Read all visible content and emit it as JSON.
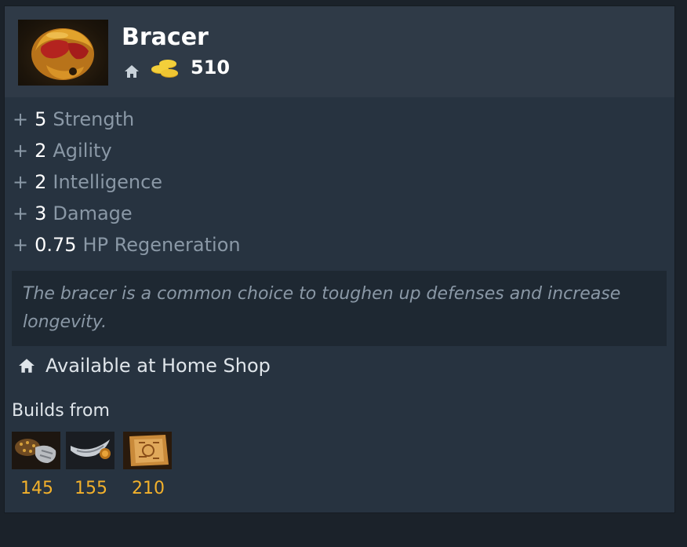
{
  "item": {
    "name": "Bracer",
    "image_icon": "bracer-helmet-icon",
    "cost": "510",
    "shop_icon": "home-icon",
    "currency_icon": "gold-coins-icon"
  },
  "attributes": [
    {
      "plus": "+",
      "value": "5",
      "label": "Strength"
    },
    {
      "plus": "+",
      "value": "2",
      "label": "Agility"
    },
    {
      "plus": "+",
      "value": "2",
      "label": "Intelligence"
    },
    {
      "plus": "+",
      "value": "3",
      "label": "Damage"
    },
    {
      "plus": "+",
      "value": "0.75",
      "label": "HP Regeneration"
    }
  ],
  "lore": "The bracer is a common choice to toughen up defenses and increase longevity.",
  "availability": "Available at Home Shop",
  "builds_from": {
    "title": "Builds from",
    "components": [
      {
        "icon": "gauntlets-icon",
        "price": "145"
      },
      {
        "icon": "circlet-icon",
        "price": "155"
      },
      {
        "icon": "recipe-scroll-icon",
        "price": "210"
      }
    ]
  },
  "colors": {
    "background": "#1b222a",
    "panel": "#273340",
    "header": "#2f3a47",
    "lore_box": "#1e2832",
    "label_gray": "#8a98a6",
    "price_gold": "#f3b12b"
  }
}
